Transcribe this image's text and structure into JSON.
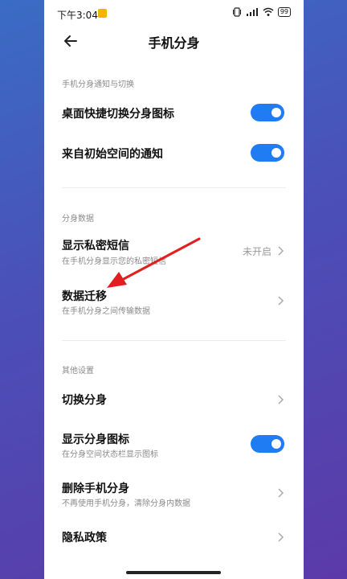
{
  "status_bar": {
    "time": "下午3:04",
    "battery": "99"
  },
  "header": {
    "title": "手机分身"
  },
  "sections": {
    "notifications": "手机分身通知与切换",
    "data": "分身数据",
    "other": "其他设置"
  },
  "items": {
    "desktop_toggle": {
      "label": "桌面快捷切换分身图标"
    },
    "initial_space_notice": {
      "label": "来自初始空间的通知"
    },
    "private_sms": {
      "label": "显示私密短信",
      "sub": "在手机分身显示您的私密短信",
      "value": "未开启"
    },
    "data_migration": {
      "label": "数据迁移",
      "sub": "在手机分身之间传输数据"
    },
    "switch_clone": {
      "label": "切换分身"
    },
    "show_clone_icon": {
      "label": "显示分身图标",
      "sub": "在分身空间状态栏显示图标"
    },
    "delete_clone": {
      "label": "删除手机分身",
      "sub": "不再使用手机分身，清除分身内数据"
    },
    "privacy_policy": {
      "label": "隐私政策"
    }
  },
  "colors": {
    "toggle_on": "#1f7cf3",
    "annotation_arrow": "#e02020"
  }
}
